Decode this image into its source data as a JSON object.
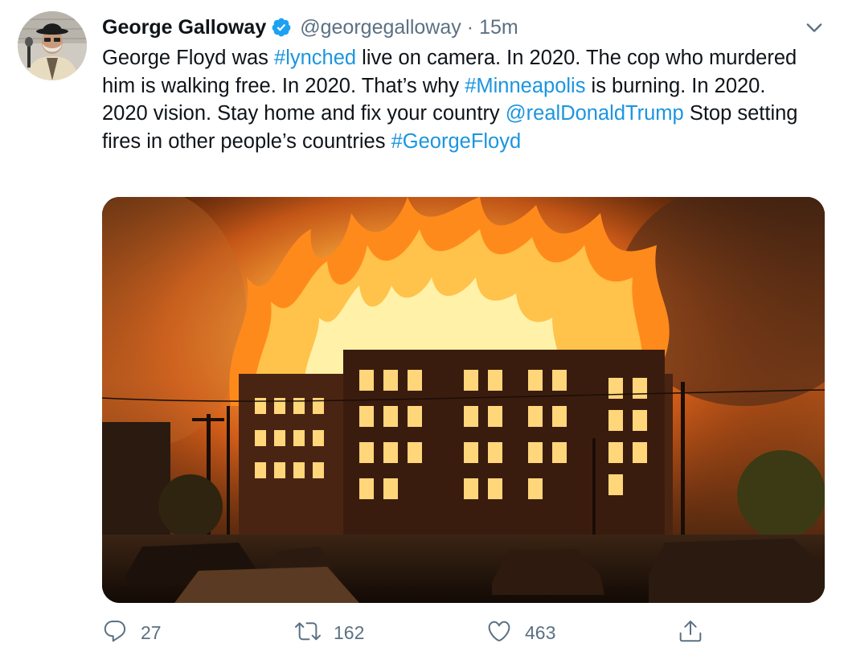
{
  "tweet": {
    "author": {
      "display_name": "George Galloway",
      "handle": "@georgegalloway",
      "separator": "·",
      "time": "15m",
      "verified": true
    },
    "text": {
      "seg1": "George Floyd was ",
      "hashtag1": "#lynched",
      "seg2": " live on camera. In 2020. The cop who murdered him is walking free. In 2020. That’s why ",
      "hashtag2": "#Minneapolis",
      "seg3": " is burning. In 2020. 2020 vision. Stay home and fix your country ",
      "mention": "@realDonaldTrump",
      "seg4": " Stop setting fires in other people’s countries ",
      "hashtag3": "#GeorgeFloyd"
    },
    "media": {
      "description_icon": "photo-burning-building"
    },
    "actions": {
      "reply_count": "27",
      "retweet_count": "162",
      "like_count": "463"
    },
    "colors": {
      "link": "#1b95e0",
      "secondary_text": "#5b7083",
      "verified_badge": "#1da1f2"
    },
    "icons": {
      "reply": "reply-icon",
      "retweet": "retweet-icon",
      "like": "heart-icon",
      "share": "share-icon",
      "more": "chevron-down-icon"
    }
  }
}
